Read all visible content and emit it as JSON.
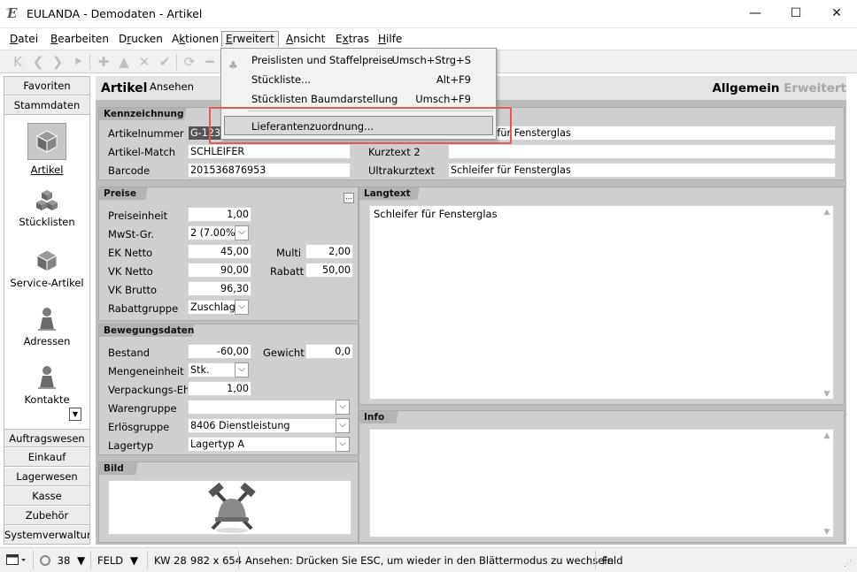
{
  "window": {
    "title": "EULANDA - Demodaten - Artikel",
    "icon": "eulanda-logo-icon",
    "min": "—",
    "max": "☐",
    "close": "✕"
  },
  "menubar": [
    {
      "id": "datei",
      "pre": "",
      "u": "D",
      "post": "atei"
    },
    {
      "id": "bearbeiten",
      "pre": "",
      "u": "B",
      "post": "earbeiten"
    },
    {
      "id": "drucken",
      "pre": "D",
      "u": "r",
      "post": "ucken"
    },
    {
      "id": "aktionen",
      "pre": "A",
      "u": "k",
      "post": "tionen"
    },
    {
      "id": "erweitert",
      "pre": "",
      "u": "E",
      "post": "rweitert"
    },
    {
      "id": "ansicht",
      "pre": "",
      "u": "A",
      "post": "nsicht"
    },
    {
      "id": "extras",
      "pre": "E",
      "u": "x",
      "post": "tras"
    },
    {
      "id": "hilfe",
      "pre": "",
      "u": "H",
      "post": "ilfe"
    }
  ],
  "toolbar": [
    {
      "name": "first-record-icon",
      "glyph": "K"
    },
    {
      "name": "prev-record-icon",
      "glyph": "❮"
    },
    {
      "name": "next-record-icon",
      "glyph": "❯"
    },
    {
      "name": "last-record-icon",
      "glyph": "⯈"
    },
    {
      "name": "add-icon",
      "glyph": "✚"
    },
    {
      "name": "up-icon",
      "glyph": "▲"
    },
    {
      "name": "delete-icon",
      "glyph": "✕"
    },
    {
      "name": "confirm-icon",
      "glyph": "✔"
    },
    {
      "name": "refresh-icon",
      "glyph": "⟳"
    },
    {
      "name": "minus-icon",
      "glyph": "━"
    }
  ],
  "erweitert_menu": [
    {
      "label": "Preislisten und Staffelpreise",
      "shortcut": "Umsch+Strg+S"
    },
    {
      "label": "Stückliste...",
      "shortcut": "Alt+F9"
    },
    {
      "label": "Stücklisten Baumdarstellung",
      "shortcut": "Umsch+F9"
    },
    {
      "label": "Lieferantenzuordnung...",
      "shortcut": ""
    }
  ],
  "sidebar": {
    "tabs_top": [
      "Favoriten",
      "Stammdaten"
    ],
    "items": [
      {
        "label": "Artikel",
        "icon": "cube-icon",
        "selected": true
      },
      {
        "label": "Stücklisten",
        "icon": "cubes-icon",
        "selected": false
      },
      {
        "label": "Service-Artikel",
        "icon": "cube-icon",
        "selected": false
      },
      {
        "label": "Adressen",
        "icon": "person-icon",
        "selected": false
      },
      {
        "label": "Kontakte",
        "icon": "person-icon",
        "selected": false
      }
    ],
    "tabs_bottom": [
      "Auftragswesen",
      "Einkauf",
      "Lagerwesen",
      "Kasse",
      "Zubehör",
      "Systemverwaltung"
    ]
  },
  "header": {
    "title": "Artikel",
    "subtitle": "Ansehen",
    "tab_active": "Allgemein",
    "tab_inactive": "Erweitert"
  },
  "kennzeichnung": {
    "title": "Kennzeichnung",
    "artikelnummer_label": "Artikelnummer",
    "artikelnummer": "G-123-0",
    "artikelmatch_label": "Artikel-Match",
    "artikelmatch": "SCHLEIFER",
    "barcode_label": "Barcode",
    "barcode": "201536876953",
    "kurztext1": "Schleifer für Fensterglas",
    "kurztext2_label": "Kurztext 2",
    "kurztext2": "",
    "ultrakurz_label": "Ultrakurztext",
    "ultrakurz": "Schleifer für Fensterglas"
  },
  "preise": {
    "title": "Preise",
    "preiseinheit_label": "Preiseinheit",
    "preiseinheit": "1,00",
    "mwst_label": "MwSt-Gr.",
    "mwst": "2 (7.00%)",
    "ek_label": "EK Netto",
    "ek": "45,00",
    "multi_label": "Multi",
    "multi": "2,00",
    "vk_label": "VK Netto",
    "vk": "90,00",
    "rabatt_label": "Rabatt",
    "rabatt": "50,00",
    "vkbrutto_label": "VK Brutto",
    "vkbrutto": "96,30",
    "rabattgruppe_label": "Rabattgruppe",
    "rabattgruppe": "Zuschlag"
  },
  "langtext": {
    "title": "Langtext",
    "text": "Schleifer für Fensterglas"
  },
  "bewegungsdaten": {
    "title": "Bewegungsdaten",
    "bestand_label": "Bestand",
    "bestand": "-60,00",
    "gewicht_label": "Gewicht",
    "gewicht": "0,0",
    "mengeneinheit_label": "Mengeneinheit",
    "mengeneinheit": "Stk.",
    "verpackung_label": "Verpackungs-Eh",
    "verpackung": "1,00",
    "warengruppe_label": "Warengruppe",
    "warengruppe": "",
    "erloesgruppe_label": "Erlösgruppe",
    "erloesgruppe": "8406 Dienstleistung",
    "lagertyp_label": "Lagertyp",
    "lagertyp": "Lagertyp A"
  },
  "info": {
    "title": "Info",
    "text": ""
  },
  "bild": {
    "title": "Bild",
    "image": "tools-helmet-icon"
  },
  "statusbar": {
    "zoom": "38",
    "mode": "FELD",
    "week": "KW 28",
    "size": "982 x 654",
    "message": "Ansehen: Drücken Sie ESC, um wieder in den Blättermodus zu wechseln",
    "field": "Feld"
  }
}
